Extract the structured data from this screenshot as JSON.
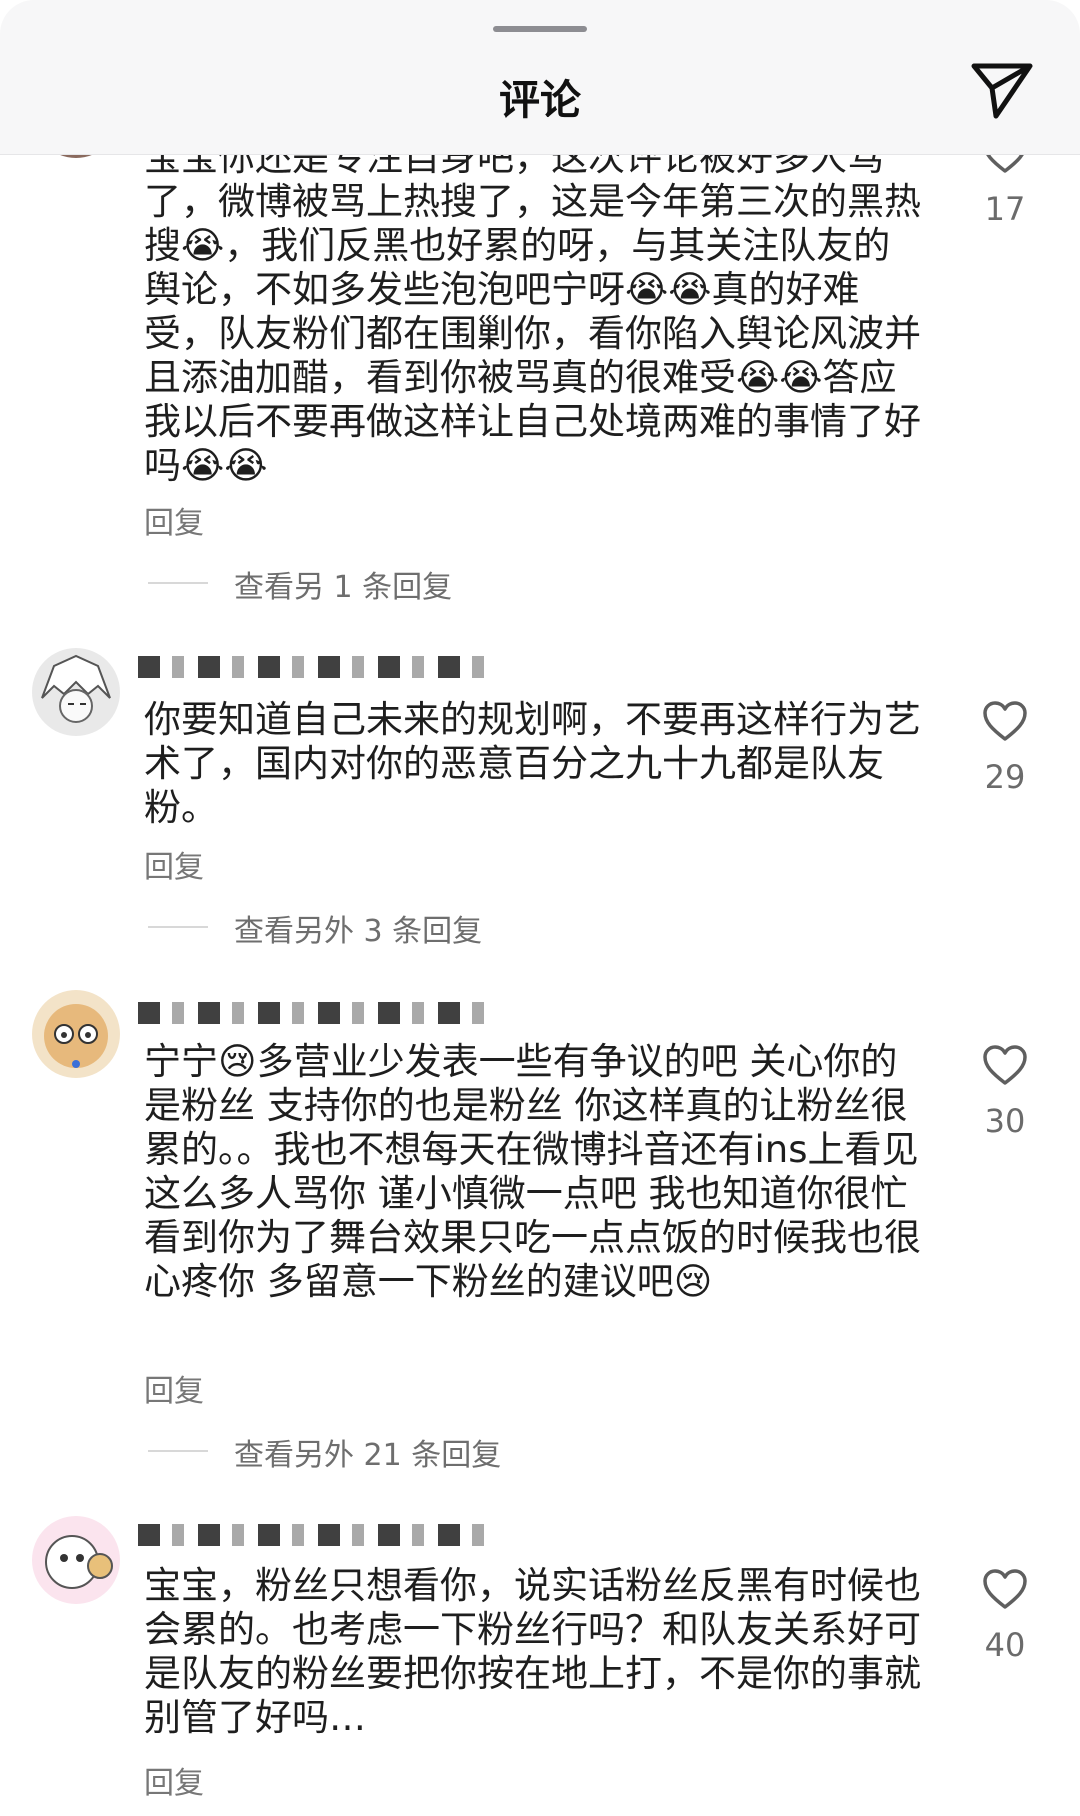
{
  "header": {
    "title": "评论",
    "send_icon": "paper-plane-icon"
  },
  "colors": {
    "sheet_bg": "#f7f7f8",
    "text": "#1e1e1e",
    "secondary": "#777777",
    "divider": "#d8d8d8"
  },
  "comments": [
    {
      "text": "宝宝你还是专注自身吧，这次评论被好多人骂了，微博被骂上热搜了，这是今年第三次的黑热搜😭，我们反黑也好累的呀，与其关注队友的舆论，不如多发些泡泡吧宁呀😭😭真的好难受，队友粉们都在围剿你，看你陷入舆论风波并且添油加醋，看到你被骂真的很难受😭😭答应我以后不要再做这样让自己处境两难的事情了好吗😭😭",
      "reply_label": "回复",
      "more_replies": "查看另 1 条回复",
      "likes": "17"
    },
    {
      "text": "你要知道自己未来的规划啊，不要再这样行为艺术了，国内对你的恶意百分之九十九都是队友粉。",
      "reply_label": "回复",
      "more_replies": "查看另外 3 条回复",
      "likes": "29"
    },
    {
      "text": "宁宁😢多营业少发表一些有争议的吧 关心你的是粉丝 支持你的也是粉丝 你这样真的让粉丝很累的。。我也不想每天在微博抖音还有ins上看见这么多人骂你 谨小慎微一点吧 我也知道你很忙 看到你为了舞台效果只吃一点点饭的时候我也很心疼你 多留意一下粉丝的建议吧😢",
      "reply_label": "回复",
      "more_replies": "查看另外 21 条回复",
      "likes": "30"
    },
    {
      "text": "宝宝，粉丝只想看你，说实话粉丝反黑有时候也会累的。也考虑一下粉丝行吗？和队友关系好可是队友的粉丝要把你按在地上打，不是你的事就别管了好吗…",
      "reply_label": "回复",
      "likes": "40"
    }
  ]
}
